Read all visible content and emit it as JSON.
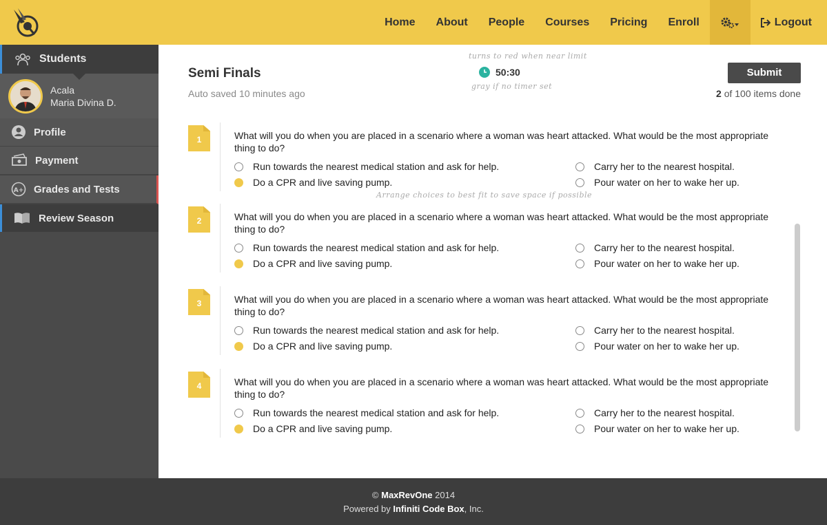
{
  "nav": {
    "items": [
      "Home",
      "About",
      "People",
      "Courses",
      "Pricing",
      "Enroll"
    ],
    "logout": "Logout"
  },
  "sidebar": {
    "students": "Students",
    "user": {
      "first": "Acala",
      "second": "Maria Divina D."
    },
    "items": [
      "Profile",
      "Payment",
      "Grades and Tests"
    ],
    "review": "Review Season"
  },
  "exam": {
    "title": "Semi Finals",
    "autosave": "Auto saved 10 minutes ago",
    "timer": "50:30",
    "note_timer_top": "turns to red when near limit",
    "note_timer_bottom": "gray if no timer set",
    "submit": "Submit",
    "progress_done": "2",
    "progress_rest": " of 100 items done",
    "note_arrange": "Arrange choices to best fit to save space if possible"
  },
  "questions": [
    {
      "number": "1",
      "text": "What will you do when you are placed in a scenario where a woman was heart attacked. What would be the most appropriate thing to do?",
      "choices": [
        "Run towards the nearest medical station and ask for help.",
        "Carry her to the nearest hospital.",
        "Do a CPR and live saving pump.",
        "Pour water on her to wake her up."
      ]
    },
    {
      "number": "2",
      "text": "What will you do when you are placed in a scenario where a woman was heart attacked. What would be the most appropriate thing to do?",
      "choices": [
        "Run towards the nearest medical station and ask for help.",
        "Carry her to the nearest hospital.",
        "Do a CPR and live saving pump.",
        "Pour water on her to wake her up."
      ]
    },
    {
      "number": "3",
      "text": "What will you do when you are placed in a scenario where a woman was heart attacked. What would be the most appropriate thing to do?",
      "choices": [
        "Run towards the nearest medical station and ask for help.",
        "Carry her to the nearest hospital.",
        "Do a CPR and live saving pump.",
        "Pour water on her to wake her up."
      ]
    },
    {
      "number": "4",
      "text": "What will you do when you are placed in a scenario where a woman was heart attacked. What would be the most appropriate thing to do?",
      "choices": [
        "Run towards the nearest medical station and ask for help.",
        "Carry her to the nearest hospital.",
        "Do a CPR and live saving pump.",
        "Pour water on her to wake her up."
      ]
    }
  ],
  "footer": {
    "copy_prefix": "© ",
    "brand": "MaxRevOne",
    "year": " 2014",
    "powered_prefix": "Powered by ",
    "powered_brand": "Infiniti Code Box",
    "powered_suffix": ", Inc."
  },
  "colors": {
    "accent": "#f0c94b",
    "sidebar": "#4a4a4a",
    "timer": "#2bb3a0",
    "blue": "#3c8fd8"
  }
}
